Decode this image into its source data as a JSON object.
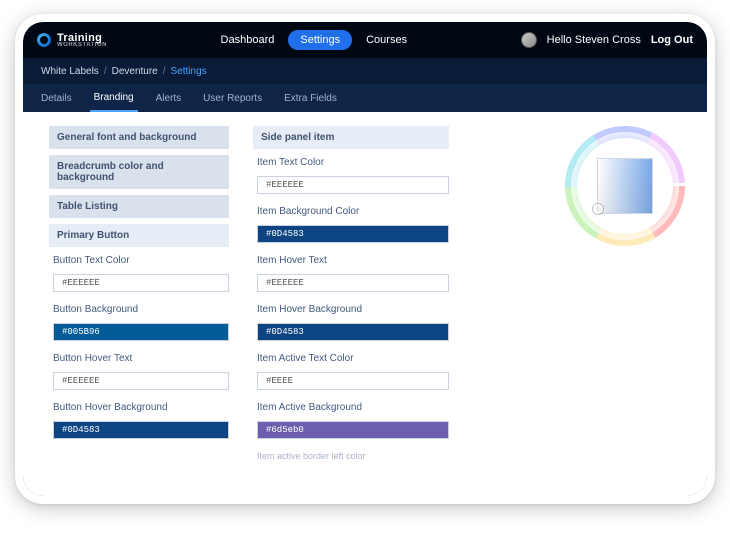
{
  "brand": {
    "name": "Training",
    "subtitle": "WORKSTATION"
  },
  "nav": {
    "dashboard": "Dashboard",
    "settings": "Settings",
    "courses": "Courses",
    "greeting": "Hello Steven Cross",
    "logout": "Log Out"
  },
  "breadcrumb": {
    "level1": "White Labels",
    "level2": "Deventure",
    "level3": "Settings"
  },
  "tabs": {
    "details": "Details",
    "branding": "Branding",
    "alerts": "Alerts",
    "user_reports": "User Reports",
    "extra_fields": "Extra Fields",
    "active": "branding"
  },
  "left_sections": {
    "general": "General font and background",
    "breadcrumb": "Breadcrumb color and background",
    "table": "Table Listing",
    "primary_button": "Primary Button"
  },
  "primary_button_fields": {
    "text_color": {
      "label": "Button Text Color",
      "value": "#EEEEEE",
      "bg": "#ffffff",
      "fg": "#555"
    },
    "background": {
      "label": "Button Background",
      "value": "#005B96",
      "bg": "#005B96",
      "fg": "#fff"
    },
    "hover_text": {
      "label": "Button Hover Text",
      "value": "#EEEEEE",
      "bg": "#ffffff",
      "fg": "#555"
    },
    "hover_bg": {
      "label": "Button Hover Background",
      "value": "#0D4583",
      "bg": "#0D4583",
      "fg": "#fff"
    }
  },
  "side_panel": {
    "heading": "Side panel item",
    "item_text": {
      "label": "Item Text Color",
      "value": "#EEEEEE",
      "bg": "#ffffff",
      "fg": "#555"
    },
    "item_bg": {
      "label": "Item Background Color",
      "value": "#0D4583",
      "bg": "#0D4583",
      "fg": "#fff"
    },
    "item_hover_text": {
      "label": "Item Hover Text",
      "value": "#EEEEEE",
      "bg": "#ffffff",
      "fg": "#555"
    },
    "item_hover_bg": {
      "label": "Item Hover Background",
      "value": "#0D4583",
      "bg": "#0D4583",
      "fg": "#fff"
    },
    "item_active_text": {
      "label": "Item Active Text Color",
      "value": "#EEEE",
      "bg": "#ffffff",
      "fg": "#555"
    },
    "item_active_bg": {
      "label": "Item Active Background",
      "value": "#6d5eb0",
      "bg": "#6d5eb0",
      "fg": "#fff"
    },
    "truncated": "Item active border left color"
  },
  "colors": {
    "accent": "#1f6feb",
    "tab_underline": "#4aa3ff"
  }
}
